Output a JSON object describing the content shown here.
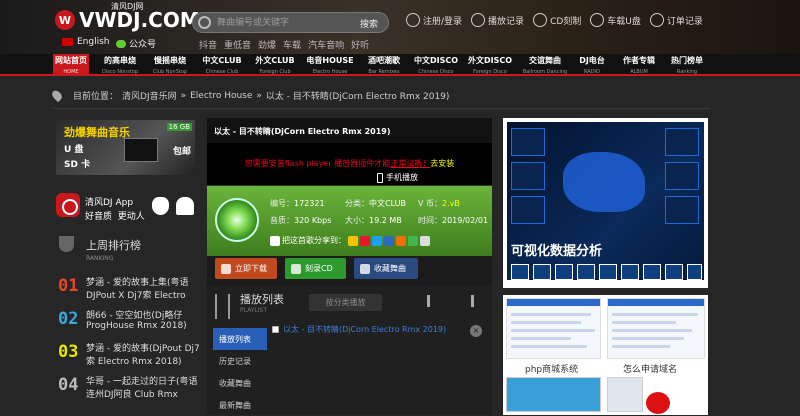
{
  "header": {
    "logo_mark": "W",
    "logo_text": "VWDJ.COM",
    "logo_sub": "清风DJ网",
    "lang": "English",
    "wechat": "公众号",
    "search_placeholder": "舞曲编号或关键字",
    "search_button": "搜索",
    "hot": [
      "抖音",
      "重低音",
      "劲爆",
      "车载",
      "汽车音响",
      "好听"
    ],
    "top_links": [
      "注册/登录",
      "播放记录",
      "CD刻制",
      "车载U盘",
      "订单记录"
    ]
  },
  "nav": [
    {
      "zh": "网站首页",
      "en": "HOME"
    },
    {
      "zh": "的高串烧",
      "en": "Disco Nonstop"
    },
    {
      "zh": "慢摇串烧",
      "en": "Club NonStop"
    },
    {
      "zh": "中文CLUB",
      "en": "Chinese Club"
    },
    {
      "zh": "外文CLUB",
      "en": "Foreign Club"
    },
    {
      "zh": "电音HOUSE",
      "en": "Electro House"
    },
    {
      "zh": "酒吧潮歌",
      "en": "Bar Remixes"
    },
    {
      "zh": "中文DISCO",
      "en": "Chinese Disco"
    },
    {
      "zh": "外文DISCO",
      "en": "Foreign Disco"
    },
    {
      "zh": "交谊舞曲",
      "en": "Ballroom Dancing"
    },
    {
      "zh": "DJ电台",
      "en": "RADIO"
    },
    {
      "zh": "作者专辑",
      "en": "ALBUM"
    },
    {
      "zh": "热门榜单",
      "en": "Ranking"
    }
  ],
  "breadcrumb": {
    "prefix": "目前位置：",
    "site": "清风DJ音乐网",
    "sep": "»",
    "category": "Electro House",
    "track": "以太 - 目不转睛(DjCorn Electro Rmx 2019)"
  },
  "left_ad": {
    "line1": "劲爆舞曲音乐",
    "line2": "U 盘",
    "line3": "SD 卡",
    "tag": "16 GB",
    "bag": "包邮"
  },
  "app_promo": {
    "line1": "清风DJ App",
    "line2a": "好音质",
    "line2b": "更动人"
  },
  "ranking": {
    "title": "上周排行榜",
    "subtitle": "RANKING",
    "items": [
      {
        "num": "01",
        "line1": "梦涵 - 爱的故事上集(粤语",
        "line2": "DJPout X Dj7索 Electro",
        "color": "#e8452a"
      },
      {
        "num": "02",
        "line1": "朗66 - 空空如也(Dj略仔",
        "line2": "ProgHouse Rmx 2018)",
        "color": "#3aa8d8"
      },
      {
        "num": "03",
        "line1": "梦涵 - 爱的故事(DjPout Dj7",
        "line2": "索 Electro Rmx 2018)",
        "color": "#e6e600"
      },
      {
        "num": "04",
        "line1": "华哥 - 一起走过的日子(粤语",
        "line2": "连州DJ阿良 Club Rmx",
        "color": "#bbbbbb"
      }
    ]
  },
  "player": {
    "title": "以太 - 目不转睛(DjCorn Electro Rmx 2019)",
    "flash_msg_a": "您需要安装flash player 播放器插件才能",
    "flash_msg_b": "正常试听！",
    "flash_install": "去安装",
    "mobile_play": "手机播放",
    "info": {
      "id_label": "编号：",
      "id": "172321",
      "cat_label": "分类：",
      "cat": "中文CLUB",
      "coin_label": "V 币：",
      "coin": "2.vB",
      "quality_label": "音质：",
      "quality": "320 Kbps",
      "size_label": "大小：",
      "size": "19.2 MB",
      "date_label": "时间：",
      "date": "2019/02/01",
      "share": "把这首歌分享到："
    },
    "actions": {
      "download": "立即下载",
      "cd": "刻录CD",
      "fav": "收藏舞曲"
    },
    "playlist": {
      "title": "播放列表",
      "subtitle": "PLAYLIST",
      "mode": "按分类播放",
      "tabs": [
        "播放列表",
        "历史记录",
        "收藏舞曲",
        "最新舞曲"
      ],
      "row": "以太 - 目不转睛(DjCorn Electro Rmx 2019)",
      "close": "×"
    }
  },
  "right_ads": {
    "ad1_caption": "可视化数据分析",
    "ad2_caption_a": "php商城系统",
    "ad2_caption_b": "怎么申请域名"
  },
  "colors": {
    "brand_red": "#c9171e",
    "link_blue": "#3d7bd9",
    "info_green": "#4f9a2a"
  }
}
